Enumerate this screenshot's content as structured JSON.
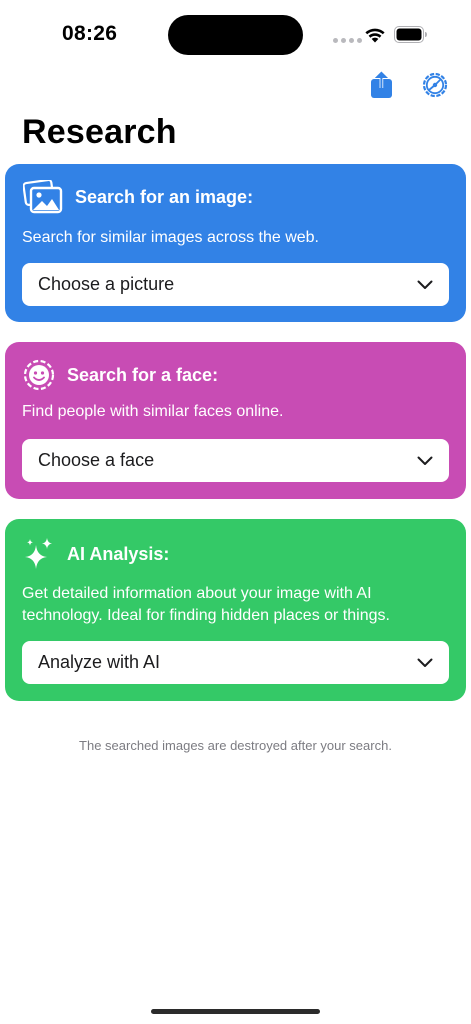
{
  "status_bar": {
    "time": "08:26"
  },
  "toolbar": {
    "share_icon": "share-icon",
    "settings_icon": "gear-icon"
  },
  "page": {
    "title": "Research"
  },
  "cards": [
    {
      "color": "#3282e6",
      "icon": "photos-icon",
      "title": "Search for an image:",
      "description": "Search for similar images across the web.",
      "select_value": "Choose a picture"
    },
    {
      "color": "#c84cb4",
      "icon": "face-icon",
      "title": "Search for a face:",
      "description": "Find people with similar faces online.",
      "select_value": "Choose a face"
    },
    {
      "color": "#34c967",
      "icon": "sparkles-icon",
      "title": "AI Analysis:",
      "description": "Get detailed information about your image with AI technology. Ideal for finding hidden places or things.",
      "select_value": "Analyze with AI"
    }
  ],
  "footer": {
    "note": "The searched images are destroyed after your search."
  }
}
